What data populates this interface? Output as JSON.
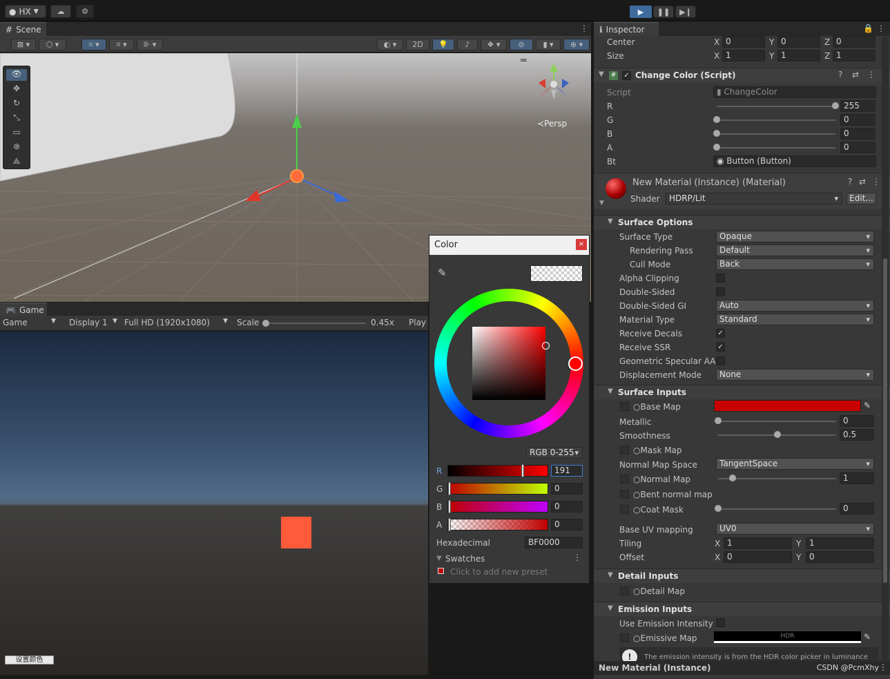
{
  "toolbar": {
    "account_label": "HX",
    "cloud_icon": "cloud-icon",
    "play_icon": "▶",
    "pause_icon": "❚❚",
    "step_icon": "▶❙"
  },
  "scene": {
    "tab_label": "Scene",
    "mode_2d": "2D",
    "persp_label": "Persp"
  },
  "game": {
    "tab_label": "Game",
    "display_select": "Game",
    "display_num": "Display 1",
    "resolution": "Full HD (1920x1080)",
    "scale_label": "Scale",
    "scale_value": "0.45x",
    "play_label": "Play",
    "button_text": "设置颜色"
  },
  "inspector": {
    "tab_label": "Inspector",
    "center_label": "Center",
    "size_label": "Size",
    "center": {
      "x": "0",
      "y": "0",
      "z": "0"
    },
    "size": {
      "x": "1",
      "y": "1",
      "z": "1"
    },
    "axis": {
      "x": "X",
      "y": "Y",
      "z": "Z"
    },
    "script_component": {
      "title": "Change Color (Script)",
      "script_label": "Script",
      "script_value": "ChangeColor",
      "r_label": "R",
      "r_value": "255",
      "r_fraction": 1.0,
      "g_label": "G",
      "g_value": "0",
      "g_fraction": 0,
      "b_label": "B",
      "b_value": "0",
      "b_fraction": 0,
      "a_label": "A",
      "a_value": "0",
      "a_fraction": 0,
      "bt_label": "Bt",
      "bt_value": "Button (Button)"
    },
    "material": {
      "title": "New Material (Instance) (Material)",
      "shader_label": "Shader",
      "shader_value": "HDRP/Lit",
      "edit_label": "Edit..."
    },
    "surface_options": {
      "title": "Surface Options",
      "rows": [
        {
          "label": "Surface Type",
          "value": "Opaque",
          "kind": "dd",
          "indent": 0
        },
        {
          "label": "Rendering Pass",
          "value": "Default",
          "kind": "dd",
          "indent": 1
        },
        {
          "label": "Cull Mode",
          "value": "Back",
          "kind": "dd",
          "indent": 1
        },
        {
          "label": "Alpha Clipping",
          "value": "",
          "kind": "chk",
          "indent": 0
        },
        {
          "label": "Double-Sided",
          "value": "",
          "kind": "chk",
          "indent": 0
        },
        {
          "label": "Double-Sided GI",
          "value": "Auto",
          "kind": "dd",
          "indent": 0
        },
        {
          "label": "Material Type",
          "value": "Standard",
          "kind": "dd",
          "indent": 0
        },
        {
          "label": "Receive Decals",
          "value": "✓",
          "kind": "chk",
          "indent": 0
        },
        {
          "label": "Receive SSR",
          "value": "✓",
          "kind": "chk",
          "indent": 0
        },
        {
          "label": "Geometric Specular AA",
          "value": "",
          "kind": "chk",
          "indent": 0
        },
        {
          "label": "Displacement Mode",
          "value": "None",
          "kind": "dd",
          "indent": 0
        }
      ]
    },
    "surface_inputs": {
      "title": "Surface Inputs",
      "base_map": "Base Map",
      "metallic_label": "Metallic",
      "metallic_value": "0",
      "metallic_fraction": 0,
      "smoothness_label": "Smoothness",
      "smoothness_value": "0.5",
      "smoothness_fraction": 0.5,
      "mask_map": "Mask Map",
      "normal_space_label": "Normal Map Space",
      "normal_space_value": "TangentSpace",
      "normal_map": "Normal Map",
      "normal_value": "1",
      "normal_fraction": 0.12,
      "bent_normal": "Bent normal map",
      "coat_mask": "Coat Mask",
      "coat_value": "0",
      "coat_fraction": 0,
      "base_uv_label": "Base UV mapping",
      "base_uv_value": "UV0",
      "tiling_label": "Tiling",
      "tiling": {
        "x": "1",
        "y": "1"
      },
      "offset_label": "Offset",
      "offset": {
        "x": "0",
        "y": "0"
      }
    },
    "detail_inputs": {
      "title": "Detail Inputs",
      "detail_map": "Detail Map"
    },
    "emission_inputs": {
      "title": "Emission Inputs",
      "use_intensity": "Use Emission Intensity",
      "emissive_map": "Emissive Map",
      "hdr_label": "HDR",
      "info_text": "The emission intensity is from the HDR color picker in luminance"
    },
    "footer": "New Material (Instance)",
    "watermark": "CSDN @PcmXhy"
  },
  "color_picker": {
    "title": "Color",
    "mode": "RGB 0-255",
    "r_label": "R",
    "r_value": "191",
    "r_fraction": 0.75,
    "g_label": "G",
    "g_value": "0",
    "b_label": "B",
    "b_value": "0",
    "a_label": "A",
    "a_value": "0",
    "hex_label": "Hexadecimal",
    "hex_value": "BF0000",
    "swatches_label": "Swatches",
    "swatches_hint": "Click to add new preset"
  },
  "colors": {
    "base_map": "#c90000",
    "cube": "#ff5a3a",
    "accent": "#3e6b9c"
  }
}
